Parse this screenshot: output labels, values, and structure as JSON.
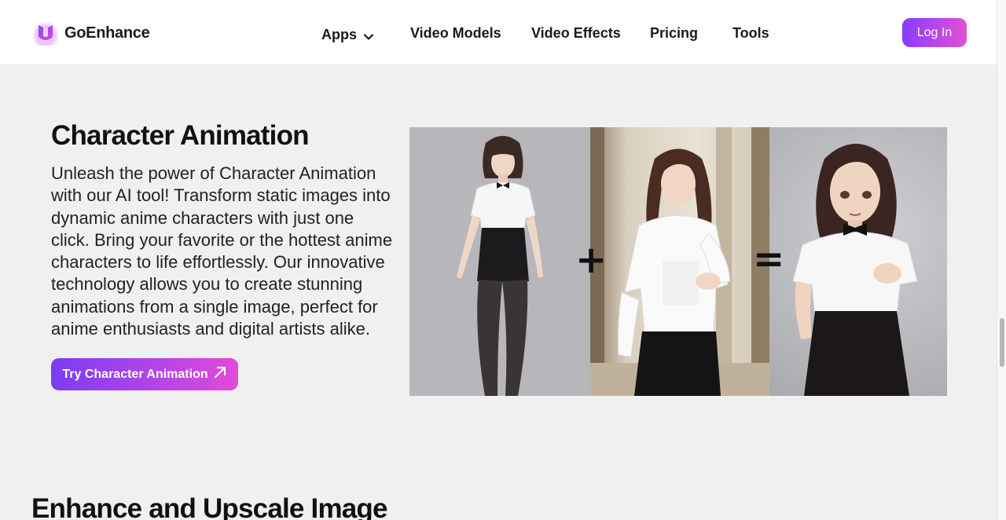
{
  "brand": {
    "name": "GoEnhance"
  },
  "nav": {
    "apps": "Apps",
    "video_models": "Video Models",
    "video_effects": "Video Effects",
    "pricing": "Pricing",
    "tools": "Tools"
  },
  "header": {
    "login_label": "Log In"
  },
  "feature": {
    "title": "Character Animation",
    "description": "Unleash the power of Character Animation with our AI tool! Transform static images into dynamic anime characters with just one click. Bring your favorite or the hottest anime characters to life effortlessly. Our innovative technology allows you to create stunning animations from a single image, perfect for anime enthusiasts and digital artists alike.",
    "cta_label": "Try Character Animation",
    "demo": {
      "operator_plus": "+",
      "operator_equals": "="
    }
  },
  "next_section": {
    "title": "Enhance and Upscale Image"
  },
  "colors": {
    "accent_start": "#8a3cff",
    "accent_end": "#e14fd6",
    "page_background": "#f0f0f0"
  }
}
